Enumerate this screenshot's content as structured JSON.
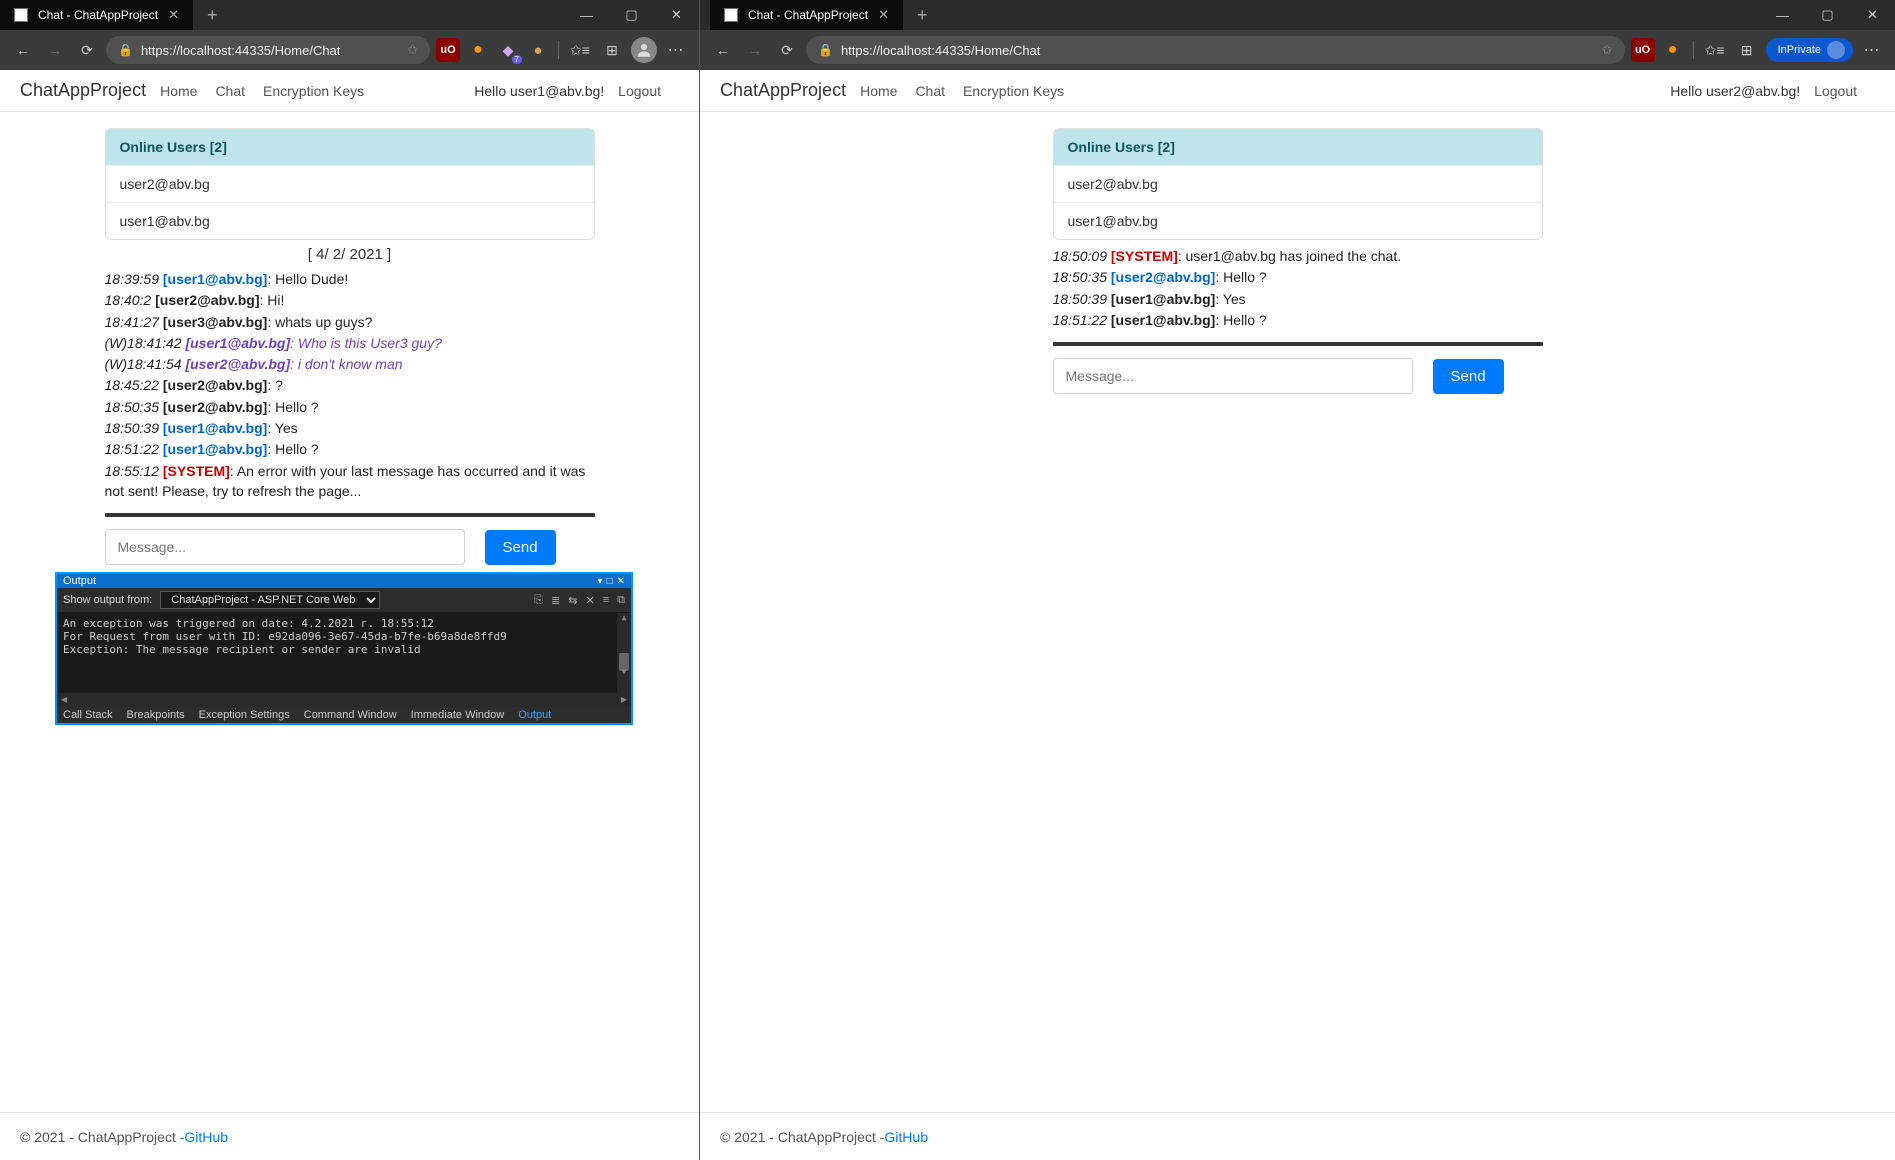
{
  "left": {
    "tabTitle": "Chat - ChatAppProject",
    "url": "https://localhost:44335/Home/Chat",
    "brand": "ChatAppProject",
    "nav": {
      "home": "Home",
      "chat": "Chat",
      "enc": "Encryption Keys"
    },
    "hello": "Hello user1@abv.bg!",
    "logout": "Logout",
    "onlineHeader": "Online Users [2]",
    "onlineUsers": [
      "user2@abv.bg",
      "user1@abv.bg"
    ],
    "dateSep": "[ 4/ 2/ 2021 ]",
    "messages": [
      {
        "ts": "18:39:59",
        "userClass": "u1",
        "user": "[user1@abv.bg]",
        "text": ": Hello Dude!"
      },
      {
        "ts": "18:40:2",
        "userClass": "u2",
        "user": "[user2@abv.bg]",
        "text": ": Hi!"
      },
      {
        "ts": "18:41:27",
        "userClass": "u3",
        "user": "[user3@abv.bg]",
        "text": ": whats up guys?"
      },
      {
        "whisper": true,
        "ts": "(W)18:41:42",
        "user": "[user1@abv.bg]",
        "text": ": Who is this User3 guy?"
      },
      {
        "whisper": true,
        "ts": "(W)18:41:54",
        "user": "[user2@abv.bg]",
        "text": ": i don't know man"
      },
      {
        "ts": "18:45:22",
        "userClass": "u2",
        "user": "[user2@abv.bg]",
        "text": ": ?"
      },
      {
        "ts": "18:50:35",
        "userClass": "u2",
        "user": "[user2@abv.bg]",
        "text": ": Hello ?"
      },
      {
        "ts": "18:50:39",
        "userClass": "u1",
        "user": "[user1@abv.bg]",
        "text": ": Yes"
      },
      {
        "ts": "18:51:22",
        "userClass": "u1",
        "user": "[user1@abv.bg]",
        "text": ": Hello ?"
      },
      {
        "ts": "18:55:12",
        "userClass": "sys",
        "user": "[SYSTEM]",
        "text": ": An error with your last message has occurred and it was not sent! Please, try to refresh the page..."
      }
    ],
    "placeholder": "Message...",
    "send": "Send",
    "footer": {
      "copy": "© 2021 - ChatAppProject - ",
      "link": "GitHub"
    },
    "extBadge": "7"
  },
  "right": {
    "tabTitle": "Chat - ChatAppProject",
    "url": "https://localhost:44335/Home/Chat",
    "brand": "ChatAppProject",
    "nav": {
      "home": "Home",
      "chat": "Chat",
      "enc": "Encryption Keys"
    },
    "hello": "Hello user2@abv.bg!",
    "logout": "Logout",
    "inprivate": "InPrivate",
    "onlineHeader": "Online Users [2]",
    "onlineUsers": [
      "user2@abv.bg",
      "user1@abv.bg"
    ],
    "messages": [
      {
        "ts": "18:50:09",
        "userClass": "sys",
        "user": "[SYSTEM]",
        "text": ": user1@abv.bg has joined the chat."
      },
      {
        "ts": "18:50:35",
        "userClass": "u1",
        "user": "[user2@abv.bg]",
        "text": ": Hello ?"
      },
      {
        "ts": "18:50:39",
        "userClass": "u2",
        "user": "[user1@abv.bg]",
        "text": ": Yes"
      },
      {
        "ts": "18:51:22",
        "userClass": "u2",
        "user": "[user1@abv.bg]",
        "text": ": Hello ?"
      }
    ],
    "placeholder": "Message...",
    "send": "Send",
    "footer": {
      "copy": "© 2021 - ChatAppProject - ",
      "link": "GitHub"
    }
  },
  "vs": {
    "title": "Output",
    "showFrom": "Show output from:",
    "source": "ChatAppProject - ASP.NET Core Web Server",
    "lines": [
      "An exception was triggered on date: 4.2.2021 г. 18:55:12",
      "For Request from user with ID: e92da096-3e67-45da-b7fe-b69a8de8ffd9",
      "Exception: The message recipient or sender are invalid"
    ],
    "tabs": {
      "callstack": "Call Stack",
      "breakpoints": "Breakpoints",
      "exset": "Exception Settings",
      "cmdwin": "Command Window",
      "immwin": "Immediate Window",
      "output": "Output"
    }
  }
}
